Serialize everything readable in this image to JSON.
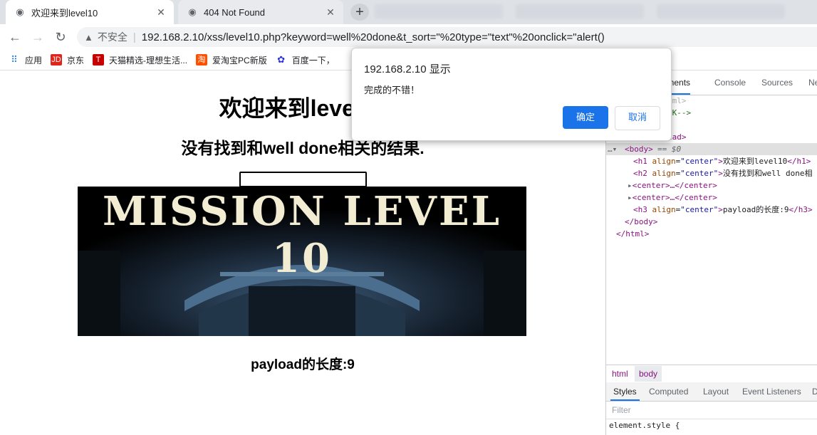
{
  "tabs": [
    {
      "title": "欢迎来到level10",
      "favicon": "globe-icon",
      "active": true
    },
    {
      "title": "404 Not Found",
      "favicon": "globe-icon",
      "active": false
    }
  ],
  "toolbar": {
    "security_label": "不安全",
    "url": "192.168.2.10/xss/level10.php?keyword=well%20done&t_sort=\"%20type=\"text\"%20onclick=\"alert()"
  },
  "bookmarks": [
    {
      "label": "应用",
      "icon": "apps-grid-icon"
    },
    {
      "label": "京东",
      "icon": "jd-icon"
    },
    {
      "label": "天猫精选-理想生活...",
      "icon": "tmall-icon"
    },
    {
      "label": "爱淘宝PC新版",
      "icon": "taobao-icon"
    },
    {
      "label": "百度一下，",
      "icon": "baidu-icon"
    }
  ],
  "page": {
    "h1": "欢迎来到level10",
    "h2": "没有找到和well done相关的结果.",
    "banner_text": "MISSION LEVEL 10",
    "h3": "payload的长度:9"
  },
  "dialog": {
    "title": "192.168.2.10 显示",
    "message": "完成的不错！",
    "ok": "确定",
    "cancel": "取消"
  },
  "devtools": {
    "tabs": [
      "Elements",
      "Console",
      "Sources",
      "Ne"
    ],
    "code": {
      "html_close_frag": "tml>",
      "comment_frag": "OK-->",
      "head_frag": "ead>",
      "body_open": "<body>",
      "body_marker": "== $0",
      "h1_text": "欢迎来到level10",
      "h2_text": "没有找到和well done相",
      "center1": "<center>…</center>",
      "center2": "<center>…</center>",
      "h3_text": "payload的长度:9",
      "body_close": "</body>",
      "html_close": "</html>"
    },
    "breadcrumbs": [
      "html",
      "body"
    ],
    "style_tabs": [
      "Styles",
      "Computed",
      "Layout",
      "Event Listeners",
      "D"
    ],
    "filter_placeholder": "Filter",
    "element_style": "element.style {"
  }
}
